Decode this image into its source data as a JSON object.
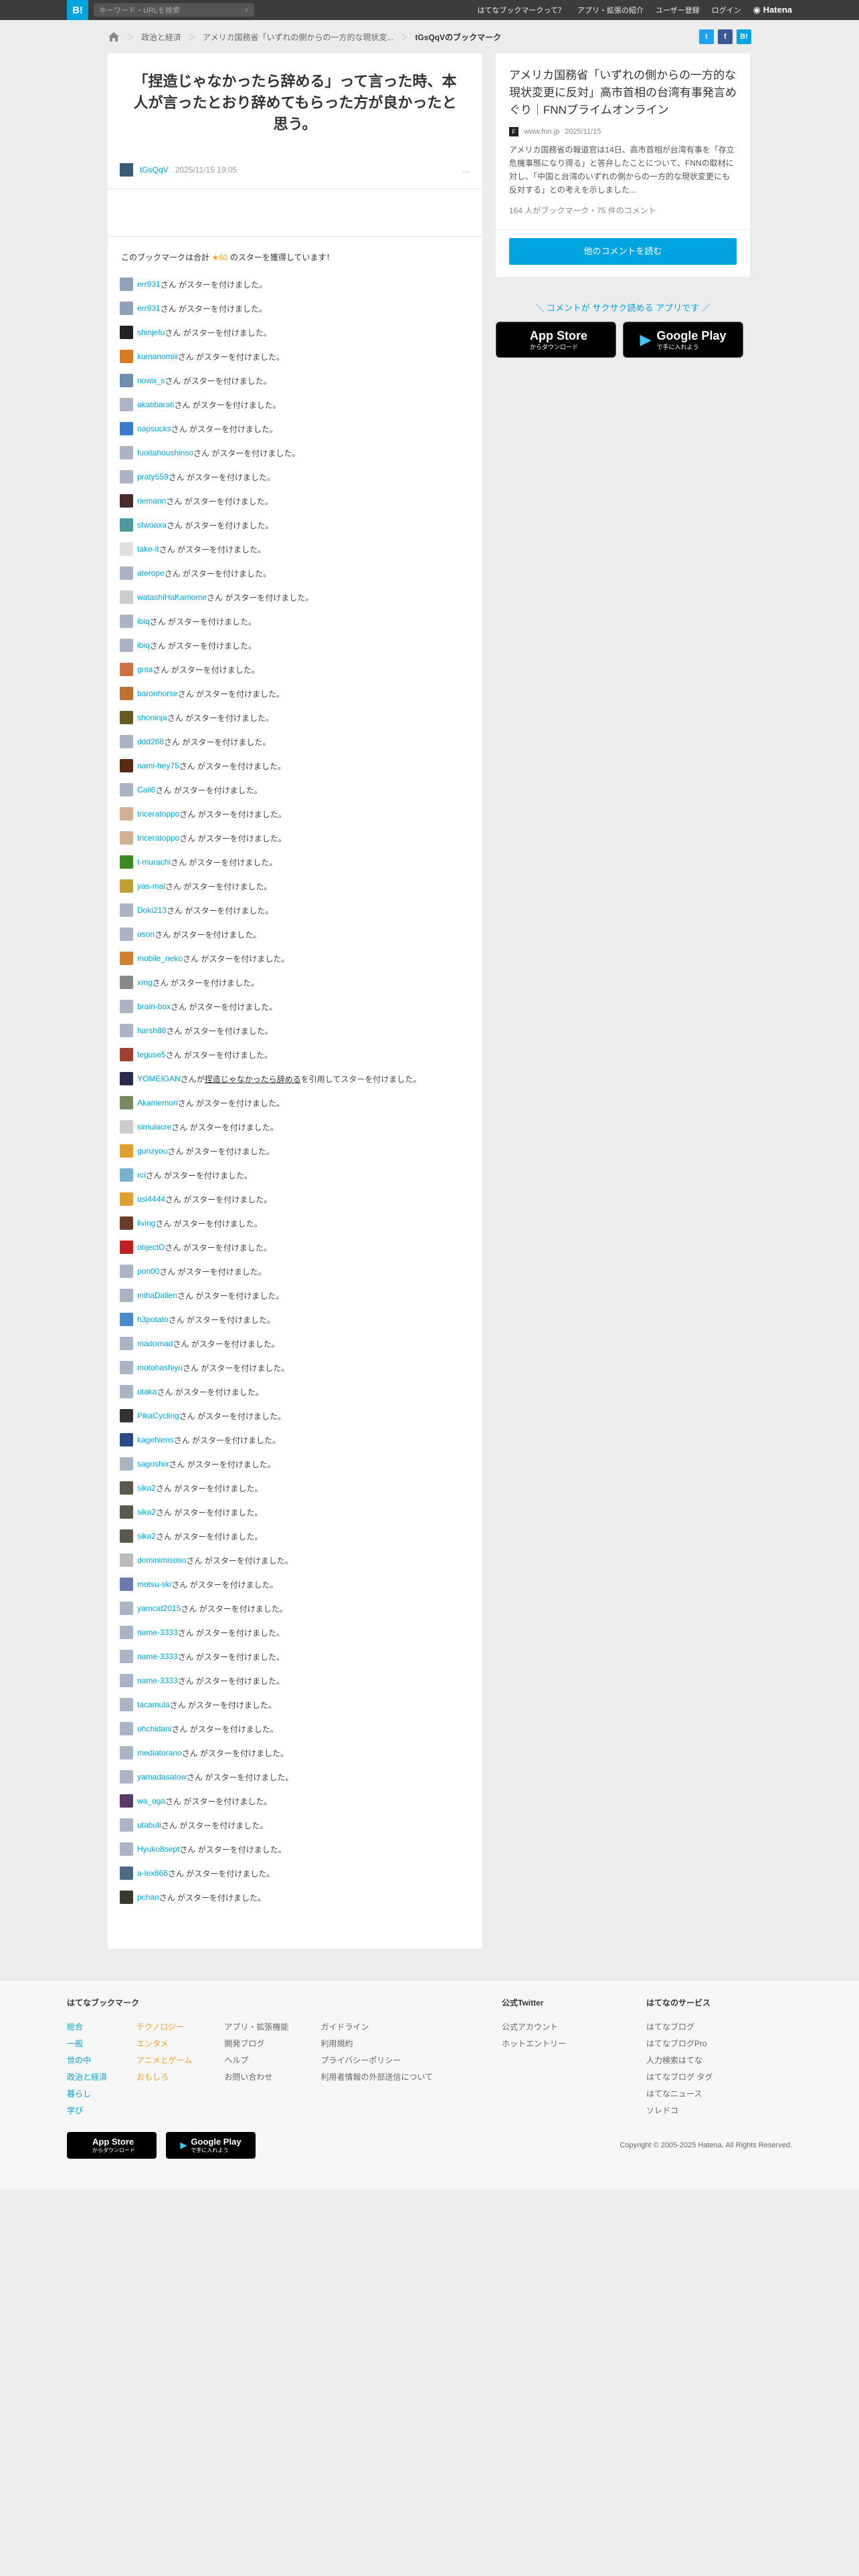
{
  "topbar": {
    "logo": "B!",
    "search_placeholder": "キーワード・URLを検索",
    "nav": [
      "はてなブックマークって？",
      "アプリ・拡張の紹介",
      "ユーザー登録",
      "ログイン"
    ],
    "brand": "Hatena"
  },
  "breadcrumb": {
    "cat": "政治と経済",
    "entry": "アメリカ国務省「いずれの側からの一方的な現状変...",
    "current": "tGsQqVのブックマーク"
  },
  "share": {
    "twitter": "t",
    "facebook": "f",
    "hatena": "B!"
  },
  "comment": {
    "text": "「捏造じゃなかったら辞める」って言った時、本人が言ったとおり辞めてもらった方が良かったと思う。",
    "user": "tGsQqV",
    "date": "2025/11/15 19:05",
    "menu": "…"
  },
  "summary": {
    "prefix": "このブックマークは合計",
    "star": "★",
    "count": "60",
    "suffix": "のスターを獲得しています！"
  },
  "star_suffix": "さん がスターを付けました。",
  "stars": [
    {
      "user": "err931",
      "c": "#8fa0b8"
    },
    {
      "user": "err931",
      "c": "#8fa0b8"
    },
    {
      "user": "shinjefu",
      "c": "#222"
    },
    {
      "user": "kumanomiii",
      "c": "#d87a20"
    },
    {
      "user": "nowa_s",
      "c": "#6a8fb0"
    },
    {
      "user": "akatibarati",
      "c": "#aab4c4"
    },
    {
      "user": "napsucks",
      "c": "#3a7ad0"
    },
    {
      "user": "fuoitahoushinso",
      "c": "#aab4c4"
    },
    {
      "user": "praty559",
      "c": "#aab4c4"
    },
    {
      "user": "riemann",
      "c": "#4a2a2a"
    },
    {
      "user": "stwoaxa",
      "c": "#4a9aa0"
    },
    {
      "user": "take-it",
      "c": "#e0e0e0"
    },
    {
      "user": "aterope",
      "c": "#aab4c4"
    },
    {
      "user": "watashiHaKamome",
      "c": "#ccc"
    },
    {
      "user": "ibiq",
      "c": "#aab4c4"
    },
    {
      "user": "ibiq",
      "c": "#aab4c4"
    },
    {
      "user": "gnta",
      "c": "#d07040"
    },
    {
      "user": "baronhorse",
      "c": "#c07030"
    },
    {
      "user": "shoninja",
      "c": "#6a5a20"
    },
    {
      "user": "ddd268",
      "c": "#aab4c4"
    },
    {
      "user": "nami-hey75",
      "c": "#5a2a10"
    },
    {
      "user": "Cali6",
      "c": "#aab4c4"
    },
    {
      "user": "triceratoppo",
      "c": "#d0b090"
    },
    {
      "user": "triceratoppo",
      "c": "#d0b090"
    },
    {
      "user": "t-murachi",
      "c": "#3a8a20"
    },
    {
      "user": "yas-mal",
      "c": "#c0a030"
    },
    {
      "user": "Doki213",
      "c": "#aab4c4"
    },
    {
      "user": "oson",
      "c": "#aab4c4"
    },
    {
      "user": "mobile_neko",
      "c": "#d08030"
    },
    {
      "user": "xmg",
      "c": "#888"
    },
    {
      "user": "brain-box",
      "c": "#aab4c4"
    },
    {
      "user": "harsh88",
      "c": "#aab4c4"
    },
    {
      "user": "teguse5",
      "c": "#a04030"
    },
    {
      "user": "YOMEIGAN",
      "c": "#2a2a4a"
    },
    {
      "user": "Akamemori",
      "c": "#7a8a60"
    },
    {
      "user": "simulacre",
      "c": "#ccc"
    },
    {
      "user": "gunzyou",
      "c": "#e0a030"
    },
    {
      "user": "rci",
      "c": "#7ab0d0"
    },
    {
      "user": "usi4444",
      "c": "#e0a030"
    },
    {
      "user": "living",
      "c": "#6a3a2a"
    },
    {
      "user": "objectO",
      "c": "#c02020"
    },
    {
      "user": "pon00",
      "c": "#aab4c4"
    },
    {
      "user": "mihaDalien",
      "c": "#aab4c4"
    },
    {
      "user": "h3potato",
      "c": "#4a8ad0"
    },
    {
      "user": "madomad",
      "c": "#aab4c4"
    },
    {
      "user": "motohashiyu",
      "c": "#aab4c4"
    },
    {
      "user": "utaka",
      "c": "#aab4c4"
    },
    {
      "user": "PikaCycling",
      "c": "#333"
    },
    {
      "user": "kagehiens",
      "c": "#2a4a8a"
    },
    {
      "user": "sagoshix",
      "c": "#aab4c4"
    },
    {
      "user": "sika2",
      "c": "#5a5a4a"
    },
    {
      "user": "sika2",
      "c": "#5a5a4a"
    },
    {
      "user": "sika2",
      "c": "#5a5a4a"
    },
    {
      "user": "dominimisoso",
      "c": "#bbb"
    },
    {
      "user": "motsu-ski",
      "c": "#6a7ab0"
    },
    {
      "user": "yamcat2015",
      "c": "#aab4c4"
    },
    {
      "user": "name-3333",
      "c": "#aab4c4"
    },
    {
      "user": "name-3333",
      "c": "#aab4c4"
    },
    {
      "user": "name-3333",
      "c": "#aab4c4"
    },
    {
      "user": "tacamula",
      "c": "#aab4c4"
    },
    {
      "user": "ohchidani",
      "c": "#aab4c4"
    },
    {
      "user": "mediatorano",
      "c": "#aab4c4"
    },
    {
      "user": "yamadasatow",
      "c": "#aab4c4"
    },
    {
      "user": "wa_oga",
      "c": "#5a3a6a"
    },
    {
      "user": "utabuti",
      "c": "#aab4c4"
    },
    {
      "user": "Hyuko8sept",
      "c": "#aab4c4"
    },
    {
      "user": "a-lex666",
      "c": "#4a6a8a"
    },
    {
      "user": "pchan",
      "c": "#3a3a2a"
    }
  ],
  "quote_row": {
    "index": 33,
    "mid": "が",
    "link": "捏造じゃなかったら辞める",
    "tail": "を引用してスターを付けました。"
  },
  "entry": {
    "title": "アメリカ国務省「いずれの側からの一方的な現状変更に反対」高市首相の台湾有事発言めぐり｜FNNプライムオンライン",
    "domain": "www.fnn.jp",
    "date": "2025/11/15",
    "desc": "アメリカ国務省の報道官は14日、高市首相が台湾有事を「存立危機事態になり得る」と答弁したことについて、FNNの取材に対し、「中国と台湾のいずれの側からの一方的な現状変更にも反対する」との考えを示しました...",
    "counts": "164 人がブックマーク・75 件のコメント",
    "fav": "F"
  },
  "more_button": "他のコメントを読む",
  "promo": "＼ コメントが サクサク読める アプリです ／",
  "appstore": {
    "small": "からダウンロード",
    "big": "App Store"
  },
  "googleplay": {
    "small": "で手に入れよう",
    "big": "Google Play"
  },
  "footer": {
    "h1": "はてなブックマーク",
    "col1": [
      "総合",
      "一般",
      "世の中",
      "政治と経済",
      "暮らし",
      "学び"
    ],
    "col2": [
      "テクノロジー",
      "エンタメ",
      "アニメとゲーム",
      "おもしろ"
    ],
    "col3": [
      "アプリ・拡張機能",
      "開発ブログ",
      "ヘルプ",
      "お問い合わせ"
    ],
    "col4": [
      "ガイドライン",
      "利用規約",
      "プライバシーポリシー",
      "利用者情報の外部送信について"
    ],
    "h2": "公式Twitter",
    "tw": [
      "公式アカウント",
      "ホットエントリー"
    ],
    "h3": "はてなのサービス",
    "svc": [
      "はてなブログ",
      "はてなブログPro",
      "人力検索はてな",
      "はてなブログ タグ",
      "はてなニュース",
      "ソレドコ"
    ],
    "copyright": "Copyright © 2005-2025 Hatena. All Rights Reserved.",
    "appstore": {
      "small": "からダウンロード",
      "big": "App Store"
    },
    "googleplay": {
      "small": "で手に入れよう",
      "big": "Google Play"
    }
  },
  "colors": {
    "accent": "#00a4de",
    "topbar": "#3c3c3c",
    "star": "#f5a623",
    "footer_col1": "#00a4de",
    "footer_col2": "#f0a030"
  }
}
